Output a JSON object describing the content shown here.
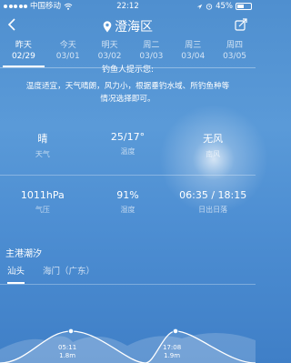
{
  "status": {
    "carrier": "中国移动",
    "time": "22:12",
    "battery": "45%"
  },
  "header": {
    "title": "澄海区"
  },
  "days": [
    {
      "name": "昨天",
      "date": "02/29",
      "active": true
    },
    {
      "name": "今天",
      "date": "03/01"
    },
    {
      "name": "明天",
      "date": "03/02"
    },
    {
      "name": "周二",
      "date": "03/03"
    },
    {
      "name": "周三",
      "date": "03/04"
    },
    {
      "name": "周四",
      "date": "03/05"
    }
  ],
  "tips": {
    "title": "钓鱼人提示您:",
    "body": "温度适宜，天气晴朗，风力小，根据垂钓水域、所钓鱼种等情况选择即可。"
  },
  "weather": {
    "row1": [
      {
        "value": "晴",
        "label": "天气"
      },
      {
        "value": "25/17°",
        "label": "温度"
      },
      {
        "value": "无风",
        "label": "南风"
      }
    ],
    "row2": [
      {
        "value": "1011hPa",
        "label": "气压"
      },
      {
        "value": "91%",
        "label": "湿度"
      },
      {
        "value": "06:35 / 18:15",
        "label": "日出日落"
      }
    ]
  },
  "tide": {
    "title": "主港潮汐",
    "tabs": [
      "汕头",
      "海门（广东）"
    ],
    "peaks": [
      {
        "time": "05:11",
        "height": "1.8m"
      },
      {
        "time": "17:08",
        "height": "1.9m"
      }
    ]
  }
}
